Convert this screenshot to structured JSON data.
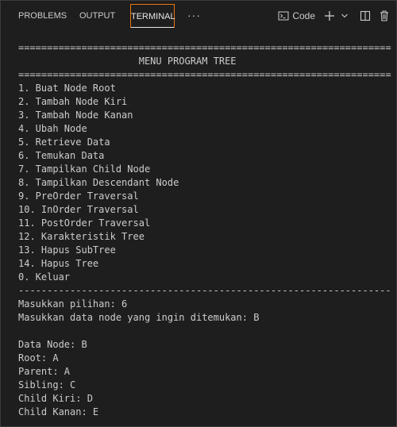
{
  "tabs": {
    "problems": "PROBLEMS",
    "output": "OUTPUT",
    "terminal": "TERMINAL",
    "more": "···"
  },
  "toolbar": {
    "shell_label": "Code",
    "shell_icon": "terminal-shell-icon",
    "add_icon": "plus-icon",
    "dropdown_icon": "chevron-down-icon",
    "split_icon": "split-terminal-icon",
    "delete_icon": "trash-icon"
  },
  "colors": {
    "background": "#1e1e1e",
    "text": "#cccccc",
    "active_tab_border": "#e9760f"
  },
  "terminal": {
    "lines": [
      "=================================================================",
      "                     MENU PROGRAM TREE",
      "=================================================================",
      "1. Buat Node Root",
      "2. Tambah Node Kiri",
      "3. Tambah Node Kanan",
      "4. Ubah Node",
      "5. Retrieve Data",
      "6. Temukan Data",
      "7. Tampilkan Child Node",
      "8. Tampilkan Descendant Node",
      "9. PreOrder Traversal",
      "10. InOrder Traversal",
      "11. PostOrder Traversal",
      "12. Karakteristik Tree",
      "13. Hapus SubTree",
      "14. Hapus Tree",
      "0. Keluar",
      "-----------------------------------------------------------------",
      "Masukkan pilihan: 6",
      "Masukkan data node yang ingin ditemukan: B",
      "",
      "Data Node: B",
      "Root: A",
      "Parent: A",
      "Sibling: C",
      "Child Kiri: D",
      "Child Kanan: E"
    ]
  }
}
